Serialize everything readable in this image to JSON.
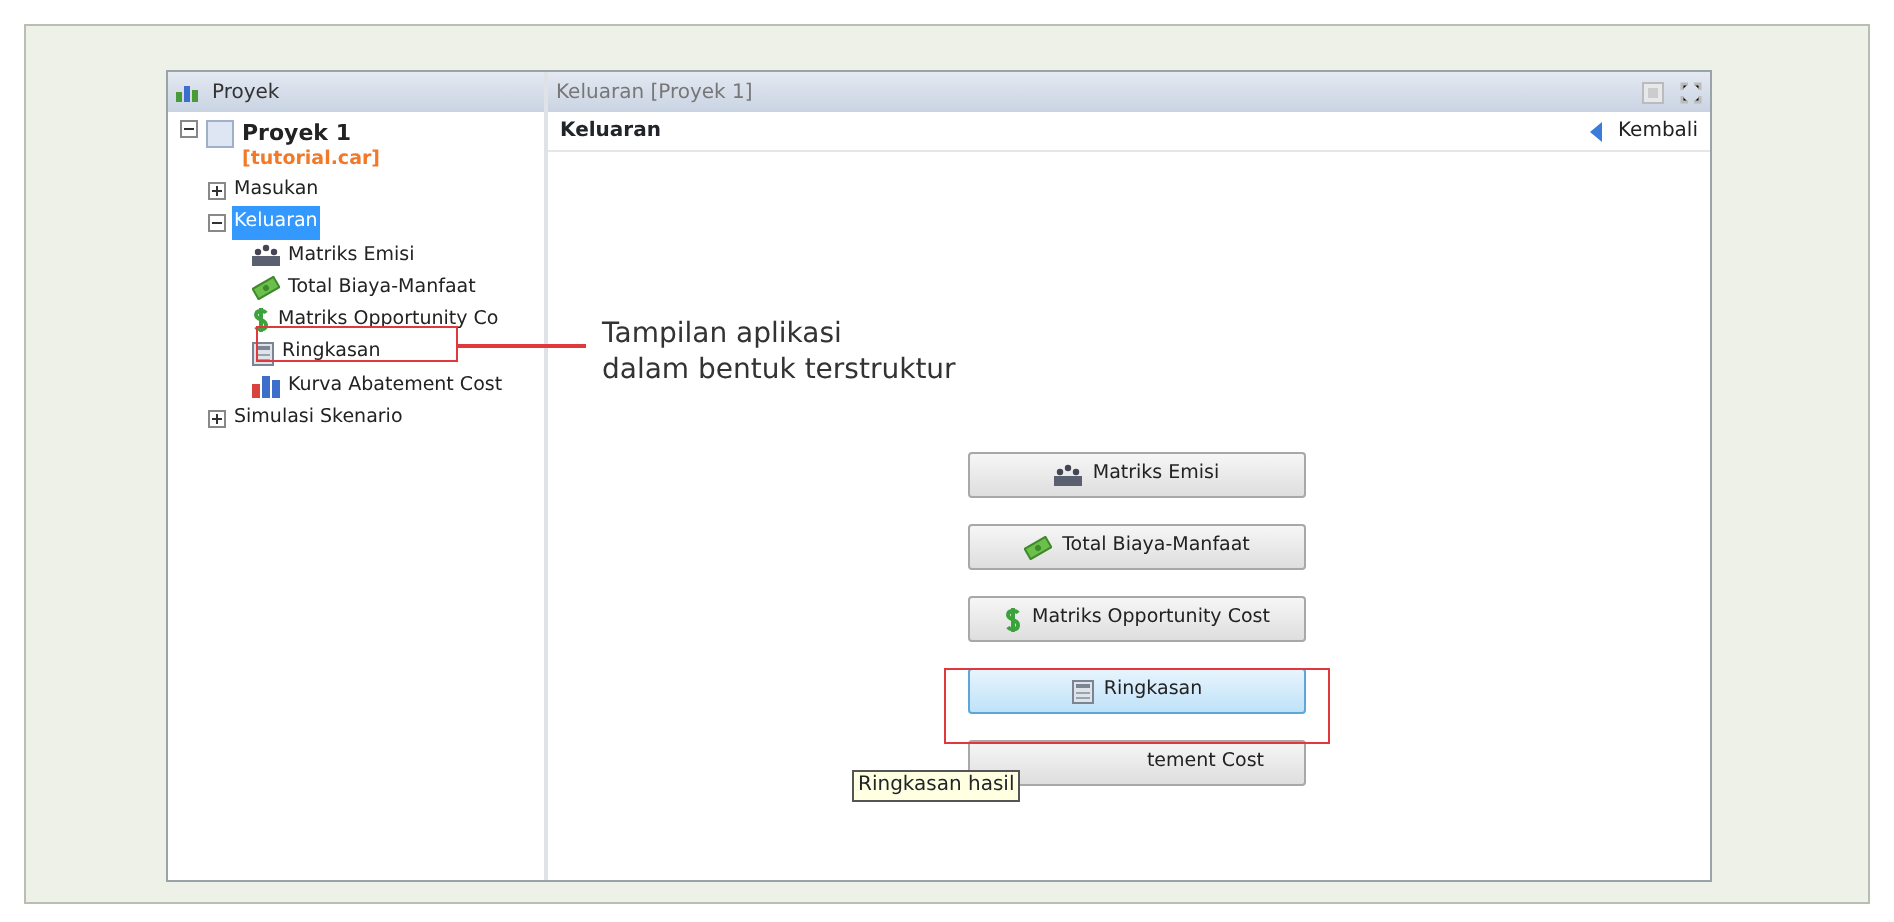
{
  "tree_panel": {
    "title": "Proyek",
    "root": {
      "label": "Proyek 1",
      "file": "[tutorial.car]",
      "expanded": true,
      "children": [
        {
          "label": "Masukan",
          "expanded": false,
          "selected": false
        },
        {
          "label": "Keluaran",
          "expanded": true,
          "selected": true,
          "children": [
            {
              "label": "Matriks Emisi",
              "kind": "emission",
              "selected": false
            },
            {
              "label": "Total Biaya-Manfaat",
              "kind": "money",
              "selected": false
            },
            {
              "label": "Matriks Opportunity Co",
              "kind": "dollar",
              "selected": false
            },
            {
              "label": "Ringkasan",
              "kind": "summary",
              "selected": false
            },
            {
              "label": "Kurva Abatement Cost",
              "kind": "chart",
              "selected": false
            }
          ]
        },
        {
          "label": "Simulasi Skenario",
          "expanded": false,
          "selected": false
        }
      ]
    }
  },
  "content_panel": {
    "title": "Keluaran [Proyek 1]",
    "heading": "Keluaran",
    "back_link": "Kembali",
    "buttons": [
      {
        "label": "Matriks Emisi",
        "kind": "emission",
        "selected": false
      },
      {
        "label": "Total Biaya-Manfaat",
        "kind": "money",
        "selected": false
      },
      {
        "label": "Matriks Opportunity Cost",
        "kind": "dollar",
        "selected": false
      },
      {
        "label": "Ringkasan",
        "kind": "summary",
        "selected": true
      },
      {
        "label": "tement Cost",
        "kind": "covered",
        "selected": false
      }
    ]
  },
  "tooltip": "Ringkasan hasil",
  "annotation": {
    "lines": [
      "Tampilan aplikasi",
      "dalam bentuk terstruktur"
    ]
  }
}
